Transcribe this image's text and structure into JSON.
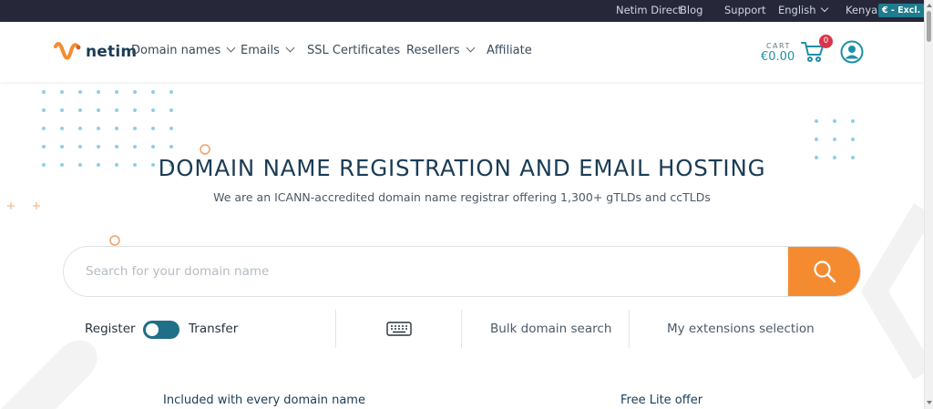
{
  "topbar": {
    "netim_direct": "Netim Direct",
    "blog": "Blog",
    "support": "Support",
    "language": "English",
    "country": "Kenya",
    "vat_badge": "€ - Excl. VAT"
  },
  "header": {
    "logo_text": "netim",
    "nav": [
      {
        "label": "Domain names",
        "dropdown": true
      },
      {
        "label": "Emails",
        "dropdown": true
      },
      {
        "label": "SSL Certificates",
        "dropdown": false
      },
      {
        "label": "Resellers",
        "dropdown": true
      },
      {
        "label": "Affiliate",
        "dropdown": false
      }
    ],
    "cart_label": "CART",
    "cart_amount": "€0.00",
    "cart_count": "0"
  },
  "hero": {
    "title": "DOMAIN NAME REGISTRATION AND EMAIL HOSTING",
    "subtitle": "We are an ICANN-accredited domain name registrar offering 1,300+ gTLDs and ccTLDs"
  },
  "search": {
    "placeholder": "Search for your domain name",
    "value": ""
  },
  "options": {
    "register_label": "Register",
    "transfer_label": "Transfer",
    "toggle_state": "register",
    "bulk_label": "Bulk domain search",
    "extensions_label": "My extensions selection"
  },
  "sections": {
    "included_title": "Included with every domain name",
    "free_offer_title": "Free Lite offer"
  },
  "colors": {
    "topbar_bg": "#26283a",
    "brand_dark": "#1b3c55",
    "accent_teal": "#1f8fa8",
    "search_orange": "#f58b30",
    "badge_red": "#d8364b",
    "dot_blue": "#8fcfe6"
  },
  "icons": {
    "logo": "netim-logo",
    "cart": "shopping-cart-icon",
    "user": "user-account-icon",
    "search": "magnifier-icon",
    "keyboard": "keyboard-icon"
  }
}
